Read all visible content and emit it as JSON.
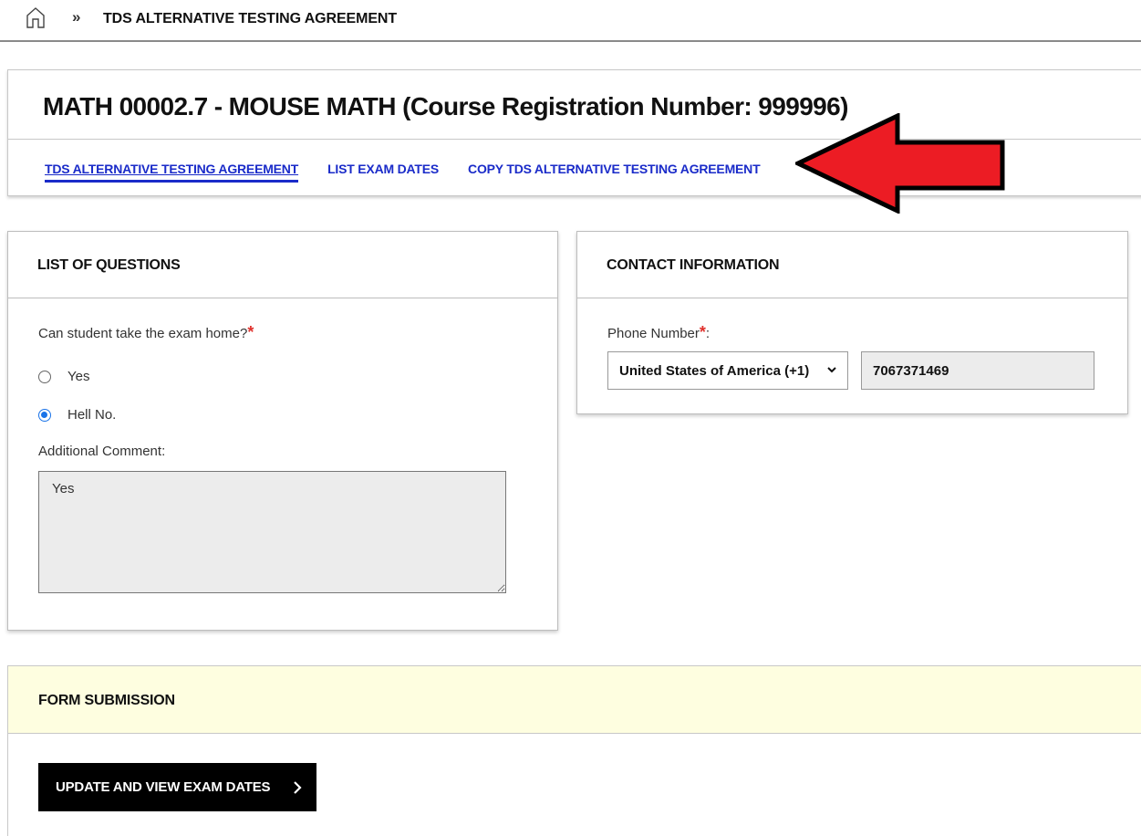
{
  "breadcrumb": {
    "separator": "»",
    "current": "TDS ALTERNATIVE TESTING AGREEMENT"
  },
  "course": {
    "title": "MATH 00002.7 - MOUSE MATH (Course Registration Number: 999996)",
    "tabs": [
      {
        "label": "TDS ALTERNATIVE TESTING AGREEMENT",
        "active": true
      },
      {
        "label": "LIST EXAM DATES",
        "active": false
      },
      {
        "label": "COPY TDS ALTERNATIVE TESTING AGREEMENT",
        "active": false
      }
    ]
  },
  "annotation": {
    "arrow_color": "#ec1c24",
    "direction": "left"
  },
  "questions": {
    "heading": "LIST OF QUESTIONS",
    "question": "Can student take the exam home?",
    "required_mark": "*",
    "options": [
      {
        "label": "Yes",
        "selected": false
      },
      {
        "label": "Hell No.",
        "selected": true
      }
    ],
    "comment_label": "Additional Comment:",
    "comment_value": "Yes"
  },
  "contact": {
    "heading": "CONTACT INFORMATION",
    "phone_label": "Phone Number",
    "required_mark": "*",
    "phone_label_suffix": ":",
    "country_selected": "United States of America (+1)",
    "phone_value": "7067371469"
  },
  "submission": {
    "heading": "FORM SUBMISSION",
    "button_label": "UPDATE AND VIEW EXAM DATES"
  },
  "colors": {
    "link": "#1a2bc9",
    "required": "#e0312c",
    "submission_header_bg": "#fefee0",
    "button_bg": "#000000"
  }
}
